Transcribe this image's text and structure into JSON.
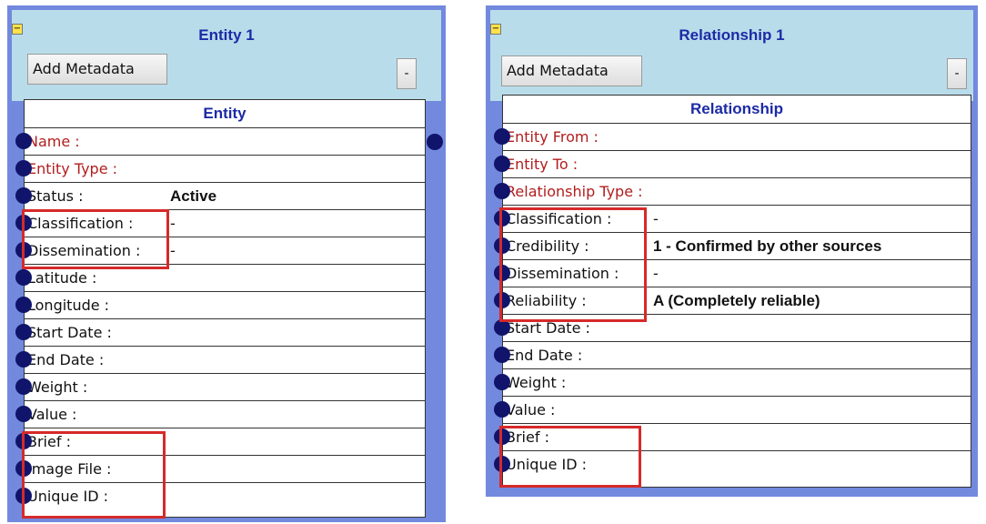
{
  "entity_panel": {
    "title": "Entity 1",
    "collapse_glyph": "−",
    "add_metadata_label": "Add Metadata",
    "minus_label": "-",
    "table_header": "Entity",
    "rows": [
      {
        "label": "Name :",
        "value": "",
        "required": true
      },
      {
        "label": "Entity Type :",
        "value": "",
        "required": true
      },
      {
        "label": "Status :",
        "value": "Active",
        "bold": true
      },
      {
        "label": "Classification :",
        "value": "-"
      },
      {
        "label": "Dissemination :",
        "value": "-"
      },
      {
        "label": "Latitude :",
        "value": ""
      },
      {
        "label": "Longitude :",
        "value": ""
      },
      {
        "label": "Start Date :",
        "value": ""
      },
      {
        "label": "End Date :",
        "value": ""
      },
      {
        "label": "Weight :",
        "value": ""
      },
      {
        "label": "Value :",
        "value": ""
      },
      {
        "label": "Brief :",
        "value": ""
      },
      {
        "label": "Image File :",
        "value": ""
      },
      {
        "label": "Unique ID :",
        "value": ""
      }
    ]
  },
  "relationship_panel": {
    "title": "Relationship 1",
    "collapse_glyph": "−",
    "add_metadata_label": "Add Metadata",
    "minus_label": "-",
    "table_header": "Relationship",
    "rows": [
      {
        "label": "Entity From :",
        "value": "",
        "required": true
      },
      {
        "label": "Entity To :",
        "value": "",
        "required": true
      },
      {
        "label": "Relationship Type :",
        "value": "",
        "required": true
      },
      {
        "label": "Classification :",
        "value": "-"
      },
      {
        "label": "Credibility :",
        "value": "1 - Confirmed by other sources",
        "bold": true
      },
      {
        "label": "Dissemination :",
        "value": "-"
      },
      {
        "label": "Reliability :",
        "value": "A (Completely reliable)",
        "bold": true
      },
      {
        "label": "Start Date :",
        "value": ""
      },
      {
        "label": "End Date :",
        "value": ""
      },
      {
        "label": "Weight :",
        "value": ""
      },
      {
        "label": "Value :",
        "value": ""
      },
      {
        "label": "Brief :",
        "value": ""
      },
      {
        "label": "Unique ID :",
        "value": ""
      }
    ]
  },
  "colors": {
    "panel_border": "#7289de",
    "panel_fill": "#b9dcea",
    "title_text": "#1c2aa6",
    "required_label": "#b21d1d",
    "connector_dot": "#10146b",
    "highlight_box": "#d62a2a"
  }
}
